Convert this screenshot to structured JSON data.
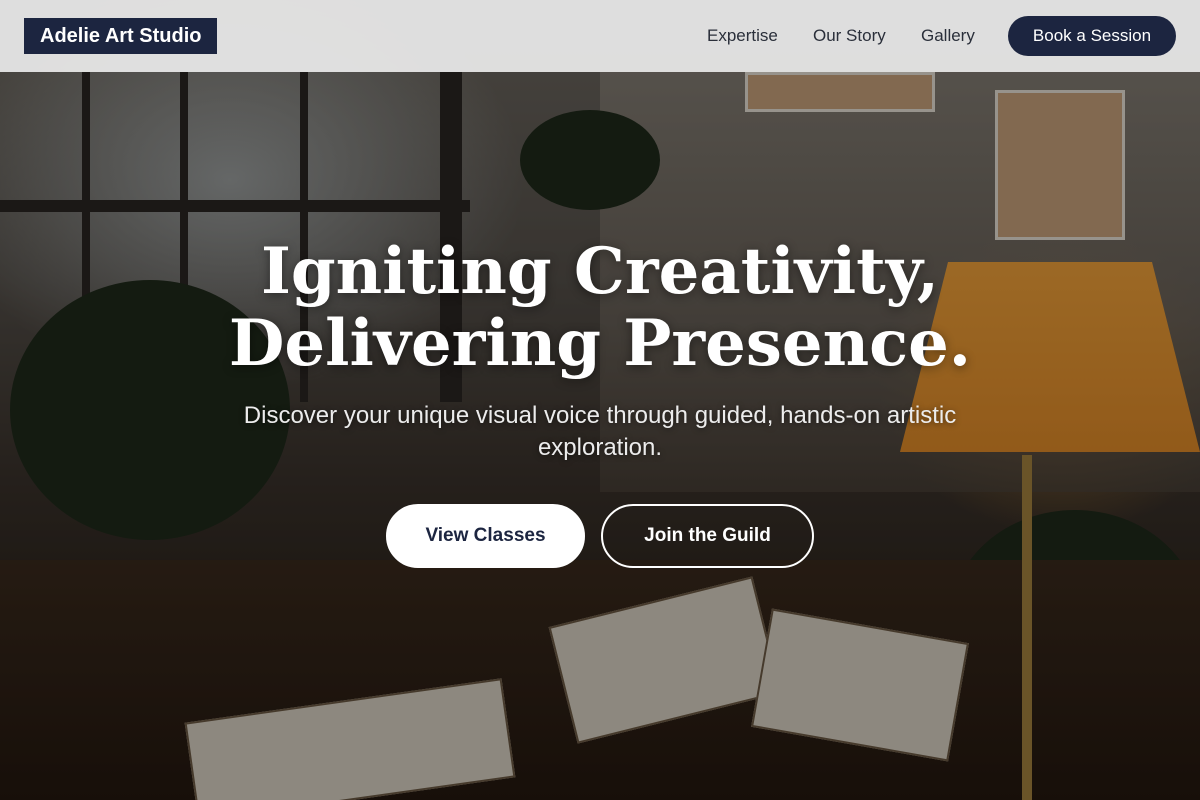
{
  "header": {
    "brand": "Adelie Art Studio",
    "nav": [
      "Expertise",
      "Our Story",
      "Gallery"
    ],
    "cta": "Book a Session"
  },
  "hero": {
    "headline_line1": "Igniting Creativity,",
    "headline_line2": "Delivering Presence.",
    "subtitle": "Discover your unique visual voice through guided, hands-on artistic exploration.",
    "primary_button": "View Classes",
    "secondary_button": "Join the Guild"
  },
  "colors": {
    "brand_navy": "#1c2540",
    "header_bg": "#ececec",
    "lamp_glow": "#f0a13a"
  }
}
